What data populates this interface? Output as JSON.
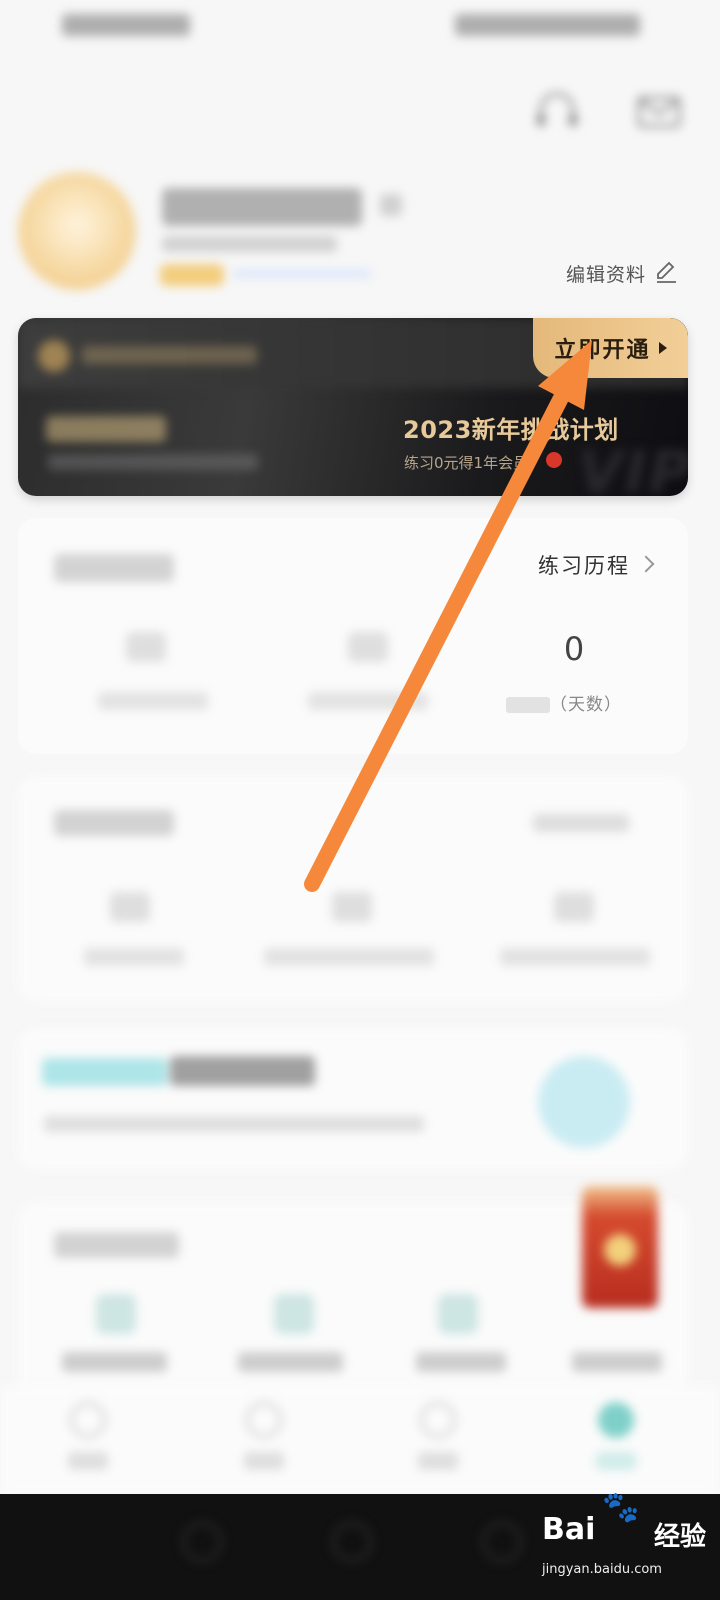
{
  "colors": {
    "accent_gold": "#e4b87a",
    "vip_bg": "#1a1a1c",
    "arrow_orange": "#f5883a",
    "promo_text": "#e8c99a",
    "red_dot": "#d8372a"
  },
  "profile": {
    "edit_label": "编辑资料",
    "edit_icon": "pencil-icon"
  },
  "vip": {
    "open_button": "立即开通",
    "promo_title": "2023新年挑战计划",
    "promo_sub": "练习0元得1年会员",
    "watermark": "VIP"
  },
  "practice": {
    "history_label": "练习历程",
    "stat_value": "0",
    "stat_label": "（天数）"
  },
  "watermark": {
    "brand": "Bai",
    "brand_cn": "经验",
    "url": "jingyan.baidu.com"
  },
  "icons": [
    "headset-icon",
    "mail-icon",
    "pencil-icon",
    "chevron-right-icon",
    "play-triangle-icon"
  ]
}
